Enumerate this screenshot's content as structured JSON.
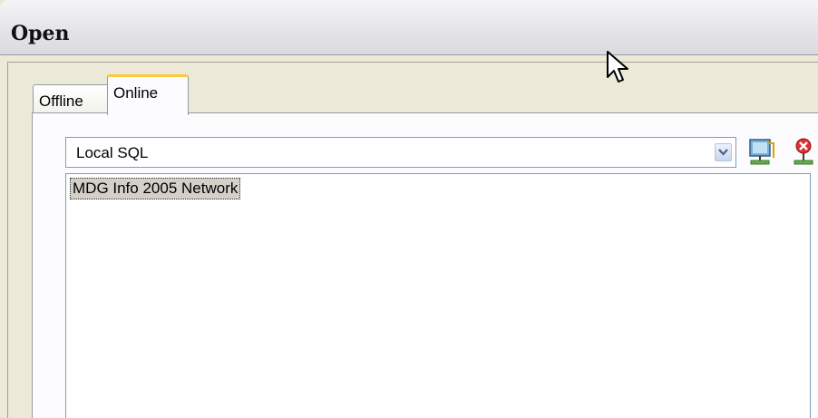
{
  "window": {
    "title": "Open"
  },
  "tabs": [
    {
      "label": "Offline",
      "selected": false
    },
    {
      "label": "Online",
      "selected": true
    }
  ],
  "source_select": {
    "value": "Local SQL"
  },
  "toolbar": {
    "connect_icon": "connect-network-icon",
    "disconnect_icon": "disconnect-network-icon"
  },
  "list": {
    "items": [
      {
        "label": "MDG Info 2005 Network",
        "selected": true
      }
    ]
  },
  "colors": {
    "tab_highlight": "#ffc83c",
    "field_border": "#7f9db9",
    "selection": "#d4d0c8"
  }
}
